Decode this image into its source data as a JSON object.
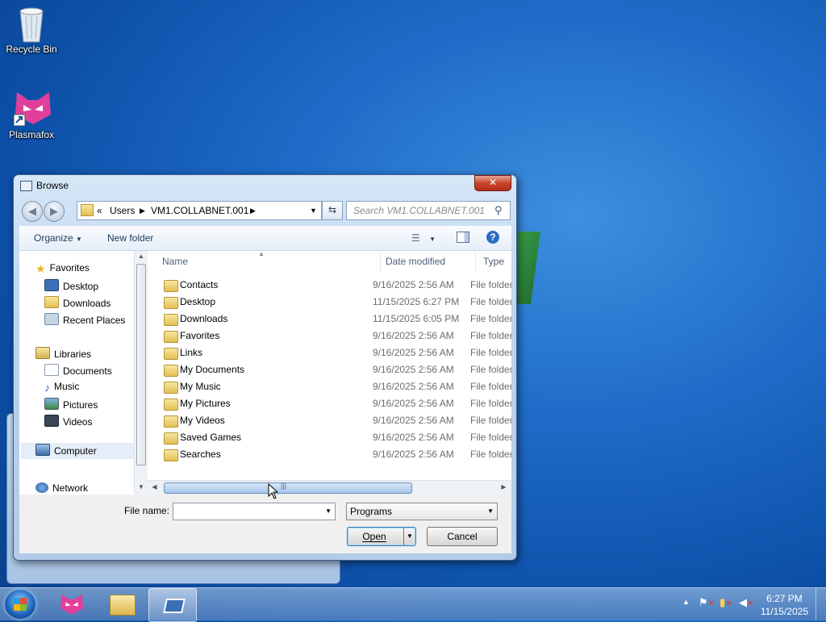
{
  "desktop": {
    "icons": [
      {
        "label": "Recycle Bin",
        "icon": "recycle-bin-icon"
      },
      {
        "label": "Plasmafox",
        "icon": "plasmafox-icon"
      }
    ]
  },
  "dialog": {
    "title": "Browse",
    "close_label": "✕",
    "address": {
      "chevrons": "«",
      "crumbs": [
        "Users",
        "VM1.COLLABNET.001"
      ]
    },
    "search_placeholder": "Search VM1.COLLABNET.001",
    "toolbar": {
      "organize": "Organize",
      "new_folder": "New folder"
    },
    "nav": {
      "favorites": "Favorites",
      "favorite_items": [
        "Desktop",
        "Downloads",
        "Recent Places"
      ],
      "libraries": "Libraries",
      "library_items": [
        "Documents",
        "Music",
        "Pictures",
        "Videos"
      ],
      "computer": "Computer",
      "network": "Network"
    },
    "columns": {
      "name": "Name",
      "date": "Date modified",
      "type": "Type"
    },
    "rows": [
      {
        "name": "Contacts",
        "date": "9/16/2025 2:56 AM",
        "type": "File folder"
      },
      {
        "name": "Desktop",
        "date": "11/15/2025 6:27 PM",
        "type": "File folder"
      },
      {
        "name": "Downloads",
        "date": "11/15/2025 6:05 PM",
        "type": "File folder"
      },
      {
        "name": "Favorites",
        "date": "9/16/2025 2:56 AM",
        "type": "File folder"
      },
      {
        "name": "Links",
        "date": "9/16/2025 2:56 AM",
        "type": "File folder"
      },
      {
        "name": "My Documents",
        "date": "9/16/2025 2:56 AM",
        "type": "File folder"
      },
      {
        "name": "My Music",
        "date": "9/16/2025 2:56 AM",
        "type": "File folder"
      },
      {
        "name": "My Pictures",
        "date": "9/16/2025 2:56 AM",
        "type": "File folder"
      },
      {
        "name": "My Videos",
        "date": "9/16/2025 2:56 AM",
        "type": "File folder"
      },
      {
        "name": "Saved Games",
        "date": "9/16/2025 2:56 AM",
        "type": "File folder"
      },
      {
        "name": "Searches",
        "date": "9/16/2025 2:56 AM",
        "type": "File folder"
      }
    ],
    "file_name_label": "File name:",
    "file_name_value": "",
    "file_type": "Programs",
    "open_label": "Open",
    "cancel_label": "Cancel"
  },
  "taskbar": {
    "time": "6:27 PM",
    "date": "11/15/2025"
  },
  "colors": {
    "accent": "#1f6cc8",
    "close": "#c8442c"
  }
}
